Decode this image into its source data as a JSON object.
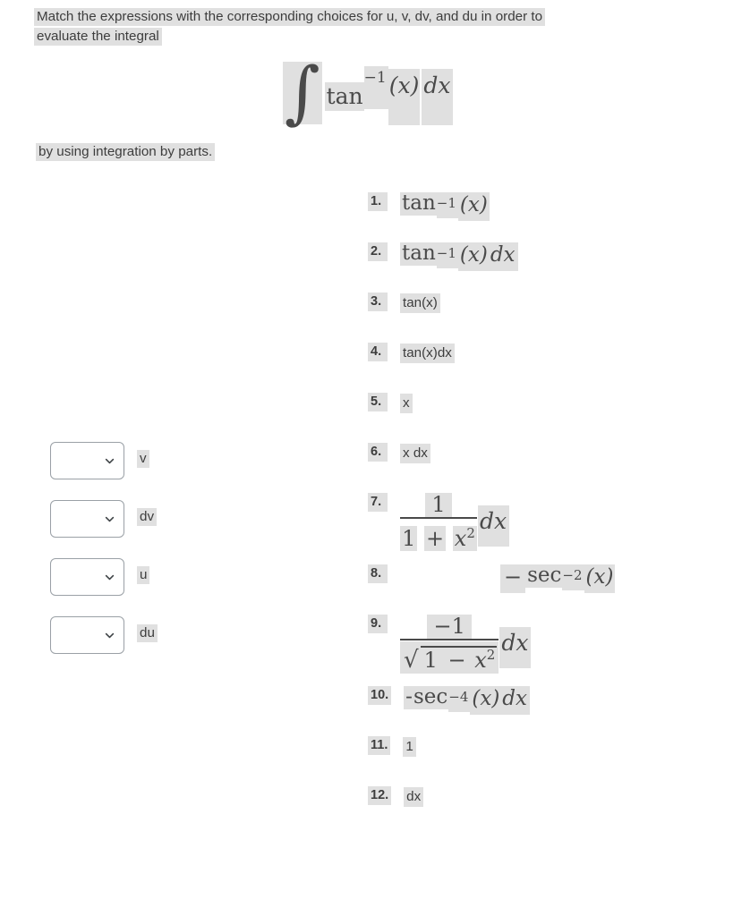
{
  "prompt": {
    "line1": "Match the expressions with the corresponding choices for u, v, dv, and du in order to",
    "line2": "evaluate the integral",
    "closing": "by using integration by parts."
  },
  "integral": {
    "sign": "∫",
    "fn": "tan",
    "exponent": "−1",
    "arg": "(x)",
    "differential": "dx",
    "plain_text": "∫ tan⁻¹(x)dx"
  },
  "dropdowns": [
    {
      "label": "v",
      "value": "",
      "placeholder": "",
      "options": [
        "",
        "1.",
        "2.",
        "3.",
        "4.",
        "5.",
        "6.",
        "7.",
        "8.",
        "9.",
        "10.",
        "11.",
        "12."
      ]
    },
    {
      "label": "dv",
      "value": "",
      "placeholder": "",
      "options": [
        "",
        "1.",
        "2.",
        "3.",
        "4.",
        "5.",
        "6.",
        "7.",
        "8.",
        "9.",
        "10.",
        "11.",
        "12."
      ]
    },
    {
      "label": "u",
      "value": "",
      "placeholder": "",
      "options": [
        "",
        "1.",
        "2.",
        "3.",
        "4.",
        "5.",
        "6.",
        "7.",
        "8.",
        "9.",
        "10.",
        "11.",
        "12."
      ]
    },
    {
      "label": "du",
      "value": "",
      "placeholder": "",
      "options": [
        "",
        "1.",
        "2.",
        "3.",
        "4.",
        "5.",
        "6.",
        "7.",
        "8.",
        "9.",
        "10.",
        "11.",
        "12."
      ]
    }
  ],
  "choices": [
    {
      "num": "1.",
      "text": "tan⁻¹(x)",
      "fn": "tan",
      "exp": "−1",
      "arg": "(x)",
      "dx": ""
    },
    {
      "num": "2.",
      "text": "tan⁻¹(x)dx",
      "fn": "tan",
      "exp": "−1",
      "arg": "(x)",
      "dx": "dx"
    },
    {
      "num": "3.",
      "text": "tan(x)"
    },
    {
      "num": "4.",
      "text": "tan(x)dx"
    },
    {
      "num": "5.",
      "text": "x"
    },
    {
      "num": "6.",
      "text": "x dx"
    },
    {
      "num": "7.",
      "text": "1/(1 + x²) dx",
      "numer": "1",
      "denom_a": "1",
      "denom_op": "+",
      "denom_b": "x",
      "denom_exp": "2",
      "dx": "dx"
    },
    {
      "num": "8.",
      "text": "− sec⁻²(x)",
      "minus": "−",
      "fn": "sec",
      "exp": "−2",
      "arg": "(x)"
    },
    {
      "num": "9.",
      "text": "−1/√(1 − x²) dx",
      "numer": "−1",
      "radical": "√",
      "denom_a": "1",
      "denom_op": "−",
      "denom_b": "x",
      "denom_exp": "2",
      "dx": "dx"
    },
    {
      "num": "10.",
      "text": "-sec⁻⁴(x)dx",
      "minus": "-",
      "fn": "sec",
      "exp": "−4",
      "arg": "(x)",
      "dx": "dx"
    },
    {
      "num": "11.",
      "text": "1"
    },
    {
      "num": "12.",
      "text": "dx"
    }
  ],
  "icons": {
    "dropdown": "chevron-down-icon"
  },
  "colors": {
    "page_background": "#ffffff",
    "text": "#3d3d3d",
    "math_text": "#4a4a4a",
    "highlight": "#e0e0e0",
    "field_border": "#9aa0a6"
  }
}
